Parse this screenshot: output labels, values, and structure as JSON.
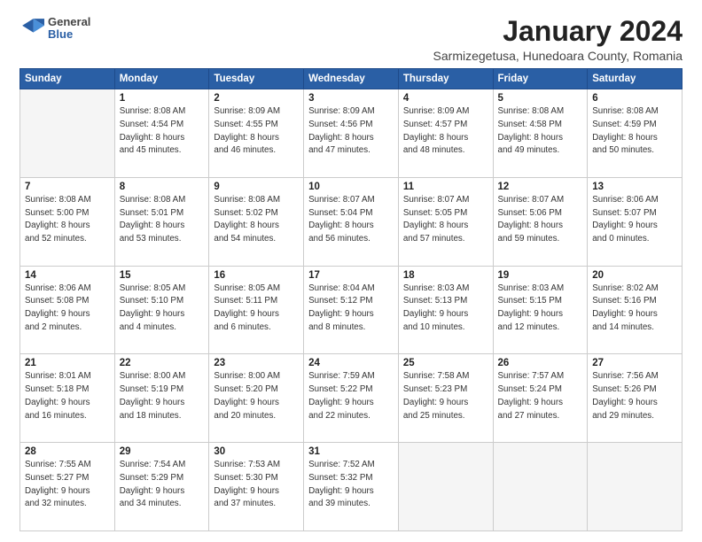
{
  "logo": {
    "general": "General",
    "blue": "Blue"
  },
  "title": "January 2024",
  "subtitle": "Sarmizegetusa, Hunedoara County, Romania",
  "days_header": [
    "Sunday",
    "Monday",
    "Tuesday",
    "Wednesday",
    "Thursday",
    "Friday",
    "Saturday"
  ],
  "weeks": [
    [
      {
        "day": "",
        "sunrise": "",
        "sunset": "",
        "daylight": ""
      },
      {
        "day": "1",
        "sunrise": "Sunrise: 8:08 AM",
        "sunset": "Sunset: 4:54 PM",
        "daylight": "Daylight: 8 hours and 45 minutes."
      },
      {
        "day": "2",
        "sunrise": "Sunrise: 8:09 AM",
        "sunset": "Sunset: 4:55 PM",
        "daylight": "Daylight: 8 hours and 46 minutes."
      },
      {
        "day": "3",
        "sunrise": "Sunrise: 8:09 AM",
        "sunset": "Sunset: 4:56 PM",
        "daylight": "Daylight: 8 hours and 47 minutes."
      },
      {
        "day": "4",
        "sunrise": "Sunrise: 8:09 AM",
        "sunset": "Sunset: 4:57 PM",
        "daylight": "Daylight: 8 hours and 48 minutes."
      },
      {
        "day": "5",
        "sunrise": "Sunrise: 8:08 AM",
        "sunset": "Sunset: 4:58 PM",
        "daylight": "Daylight: 8 hours and 49 minutes."
      },
      {
        "day": "6",
        "sunrise": "Sunrise: 8:08 AM",
        "sunset": "Sunset: 4:59 PM",
        "daylight": "Daylight: 8 hours and 50 minutes."
      }
    ],
    [
      {
        "day": "7",
        "sunrise": "Sunrise: 8:08 AM",
        "sunset": "Sunset: 5:00 PM",
        "daylight": "Daylight: 8 hours and 52 minutes."
      },
      {
        "day": "8",
        "sunrise": "Sunrise: 8:08 AM",
        "sunset": "Sunset: 5:01 PM",
        "daylight": "Daylight: 8 hours and 53 minutes."
      },
      {
        "day": "9",
        "sunrise": "Sunrise: 8:08 AM",
        "sunset": "Sunset: 5:02 PM",
        "daylight": "Daylight: 8 hours and 54 minutes."
      },
      {
        "day": "10",
        "sunrise": "Sunrise: 8:07 AM",
        "sunset": "Sunset: 5:04 PM",
        "daylight": "Daylight: 8 hours and 56 minutes."
      },
      {
        "day": "11",
        "sunrise": "Sunrise: 8:07 AM",
        "sunset": "Sunset: 5:05 PM",
        "daylight": "Daylight: 8 hours and 57 minutes."
      },
      {
        "day": "12",
        "sunrise": "Sunrise: 8:07 AM",
        "sunset": "Sunset: 5:06 PM",
        "daylight": "Daylight: 8 hours and 59 minutes."
      },
      {
        "day": "13",
        "sunrise": "Sunrise: 8:06 AM",
        "sunset": "Sunset: 5:07 PM",
        "daylight": "Daylight: 9 hours and 0 minutes."
      }
    ],
    [
      {
        "day": "14",
        "sunrise": "Sunrise: 8:06 AM",
        "sunset": "Sunset: 5:08 PM",
        "daylight": "Daylight: 9 hours and 2 minutes."
      },
      {
        "day": "15",
        "sunrise": "Sunrise: 8:05 AM",
        "sunset": "Sunset: 5:10 PM",
        "daylight": "Daylight: 9 hours and 4 minutes."
      },
      {
        "day": "16",
        "sunrise": "Sunrise: 8:05 AM",
        "sunset": "Sunset: 5:11 PM",
        "daylight": "Daylight: 9 hours and 6 minutes."
      },
      {
        "day": "17",
        "sunrise": "Sunrise: 8:04 AM",
        "sunset": "Sunset: 5:12 PM",
        "daylight": "Daylight: 9 hours and 8 minutes."
      },
      {
        "day": "18",
        "sunrise": "Sunrise: 8:03 AM",
        "sunset": "Sunset: 5:13 PM",
        "daylight": "Daylight: 9 hours and 10 minutes."
      },
      {
        "day": "19",
        "sunrise": "Sunrise: 8:03 AM",
        "sunset": "Sunset: 5:15 PM",
        "daylight": "Daylight: 9 hours and 12 minutes."
      },
      {
        "day": "20",
        "sunrise": "Sunrise: 8:02 AM",
        "sunset": "Sunset: 5:16 PM",
        "daylight": "Daylight: 9 hours and 14 minutes."
      }
    ],
    [
      {
        "day": "21",
        "sunrise": "Sunrise: 8:01 AM",
        "sunset": "Sunset: 5:18 PM",
        "daylight": "Daylight: 9 hours and 16 minutes."
      },
      {
        "day": "22",
        "sunrise": "Sunrise: 8:00 AM",
        "sunset": "Sunset: 5:19 PM",
        "daylight": "Daylight: 9 hours and 18 minutes."
      },
      {
        "day": "23",
        "sunrise": "Sunrise: 8:00 AM",
        "sunset": "Sunset: 5:20 PM",
        "daylight": "Daylight: 9 hours and 20 minutes."
      },
      {
        "day": "24",
        "sunrise": "Sunrise: 7:59 AM",
        "sunset": "Sunset: 5:22 PM",
        "daylight": "Daylight: 9 hours and 22 minutes."
      },
      {
        "day": "25",
        "sunrise": "Sunrise: 7:58 AM",
        "sunset": "Sunset: 5:23 PM",
        "daylight": "Daylight: 9 hours and 25 minutes."
      },
      {
        "day": "26",
        "sunrise": "Sunrise: 7:57 AM",
        "sunset": "Sunset: 5:24 PM",
        "daylight": "Daylight: 9 hours and 27 minutes."
      },
      {
        "day": "27",
        "sunrise": "Sunrise: 7:56 AM",
        "sunset": "Sunset: 5:26 PM",
        "daylight": "Daylight: 9 hours and 29 minutes."
      }
    ],
    [
      {
        "day": "28",
        "sunrise": "Sunrise: 7:55 AM",
        "sunset": "Sunset: 5:27 PM",
        "daylight": "Daylight: 9 hours and 32 minutes."
      },
      {
        "day": "29",
        "sunrise": "Sunrise: 7:54 AM",
        "sunset": "Sunset: 5:29 PM",
        "daylight": "Daylight: 9 hours and 34 minutes."
      },
      {
        "day": "30",
        "sunrise": "Sunrise: 7:53 AM",
        "sunset": "Sunset: 5:30 PM",
        "daylight": "Daylight: 9 hours and 37 minutes."
      },
      {
        "day": "31",
        "sunrise": "Sunrise: 7:52 AM",
        "sunset": "Sunset: 5:32 PM",
        "daylight": "Daylight: 9 hours and 39 minutes."
      },
      {
        "day": "",
        "sunrise": "",
        "sunset": "",
        "daylight": ""
      },
      {
        "day": "",
        "sunrise": "",
        "sunset": "",
        "daylight": ""
      },
      {
        "day": "",
        "sunrise": "",
        "sunset": "",
        "daylight": ""
      }
    ]
  ]
}
